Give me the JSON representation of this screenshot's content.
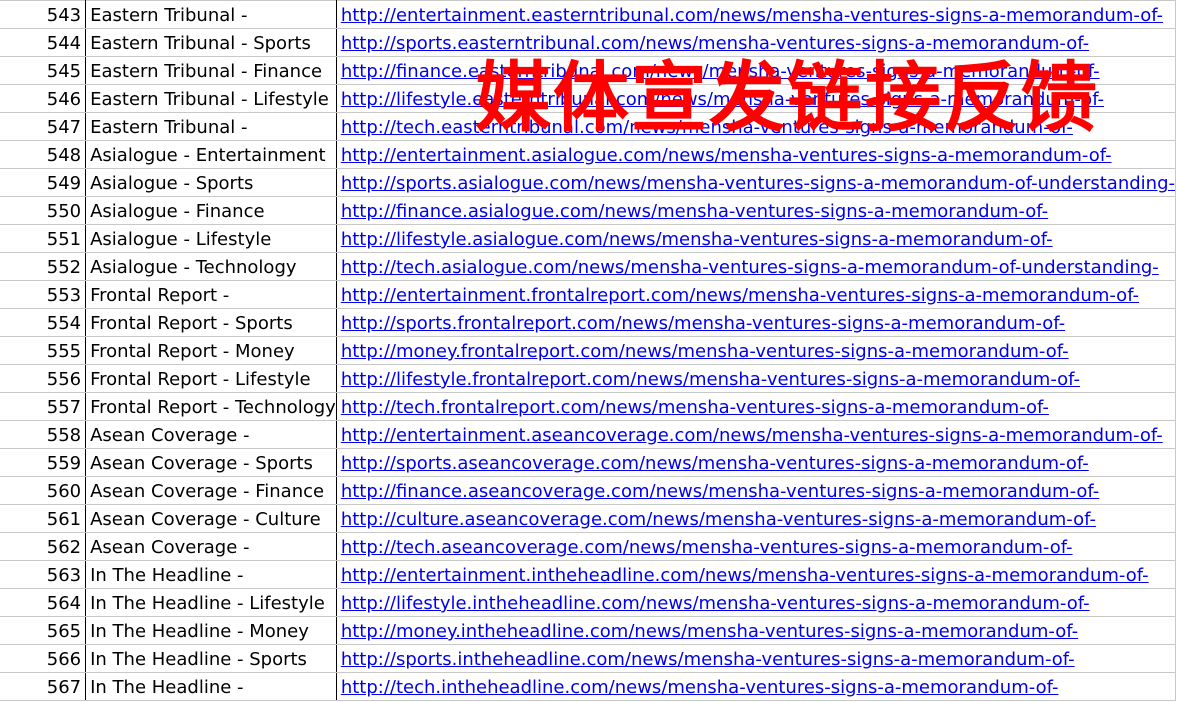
{
  "rows": [
    {
      "num": "543",
      "name": "Eastern Tribunal -",
      "url": "http://entertainment.easterntribunal.com/news/mensha-ventures-signs-a-memorandum-of-"
    },
    {
      "num": "544",
      "name": "Eastern Tribunal - Sports",
      "url": "http://sports.easterntribunal.com/news/mensha-ventures-signs-a-memorandum-of-"
    },
    {
      "num": "545",
      "name": "Eastern Tribunal - Finance",
      "url": "http://finance.easterntribunal.com/news/mensha-ventures-signs-a-memorandum-of-"
    },
    {
      "num": "546",
      "name": "Eastern Tribunal - Lifestyle",
      "url": "http://lifestyle.easterntribunal.com/news/mensha-ventures-signs-a-memorandum-of-"
    },
    {
      "num": "547",
      "name": "Eastern Tribunal -",
      "url": "http://tech.easterntribunal.com/news/mensha-ventures-signs-a-memorandum-of-"
    },
    {
      "num": "548",
      "name": "Asialogue - Entertainment",
      "url": "http://entertainment.asialogue.com/news/mensha-ventures-signs-a-memorandum-of-"
    },
    {
      "num": "549",
      "name": "Asialogue - Sports",
      "url": "http://sports.asialogue.com/news/mensha-ventures-signs-a-memorandum-of-understanding-"
    },
    {
      "num": "550",
      "name": "Asialogue - Finance",
      "url": "http://finance.asialogue.com/news/mensha-ventures-signs-a-memorandum-of-"
    },
    {
      "num": "551",
      "name": "Asialogue - Lifestyle",
      "url": "http://lifestyle.asialogue.com/news/mensha-ventures-signs-a-memorandum-of-"
    },
    {
      "num": "552",
      "name": "Asialogue - Technology",
      "url": "http://tech.asialogue.com/news/mensha-ventures-signs-a-memorandum-of-understanding-"
    },
    {
      "num": "553",
      "name": "Frontal Report -",
      "url": "http://entertainment.frontalreport.com/news/mensha-ventures-signs-a-memorandum-of-"
    },
    {
      "num": "554",
      "name": "Frontal Report - Sports",
      "url": "http://sports.frontalreport.com/news/mensha-ventures-signs-a-memorandum-of-"
    },
    {
      "num": "555",
      "name": "Frontal Report - Money",
      "url": "http://money.frontalreport.com/news/mensha-ventures-signs-a-memorandum-of-"
    },
    {
      "num": "556",
      "name": "Frontal Report - Lifestyle",
      "url": "http://lifestyle.frontalreport.com/news/mensha-ventures-signs-a-memorandum-of-"
    },
    {
      "num": "557",
      "name": "Frontal Report - Technology",
      "url": "http://tech.frontalreport.com/news/mensha-ventures-signs-a-memorandum-of-"
    },
    {
      "num": "558",
      "name": "Asean Coverage -",
      "url": "http://entertainment.aseancoverage.com/news/mensha-ventures-signs-a-memorandum-of-"
    },
    {
      "num": "559",
      "name": "Asean Coverage - Sports",
      "url": "http://sports.aseancoverage.com/news/mensha-ventures-signs-a-memorandum-of-"
    },
    {
      "num": "560",
      "name": "Asean Coverage - Finance",
      "url": "http://finance.aseancoverage.com/news/mensha-ventures-signs-a-memorandum-of-"
    },
    {
      "num": "561",
      "name": "Asean Coverage - Culture",
      "url": "http://culture.aseancoverage.com/news/mensha-ventures-signs-a-memorandum-of-"
    },
    {
      "num": "562",
      "name": "Asean Coverage -",
      "url": "http://tech.aseancoverage.com/news/mensha-ventures-signs-a-memorandum-of-"
    },
    {
      "num": "563",
      "name": "In The Headline -",
      "url": "http://entertainment.intheheadline.com/news/mensha-ventures-signs-a-memorandum-of-"
    },
    {
      "num": "564",
      "name": "In The Headline - Lifestyle",
      "url": "http://lifestyle.intheheadline.com/news/mensha-ventures-signs-a-memorandum-of-"
    },
    {
      "num": "565",
      "name": "In The Headline - Money",
      "url": "http://money.intheheadline.com/news/mensha-ventures-signs-a-memorandum-of-"
    },
    {
      "num": "566",
      "name": "In The Headline - Sports",
      "url": "http://sports.intheheadline.com/news/mensha-ventures-signs-a-memorandum-of-"
    },
    {
      "num": "567",
      "name": "In The Headline -",
      "url": "http://tech.intheheadline.com/news/mensha-ventures-signs-a-memorandum-of-"
    }
  ],
  "watermark": "媒体宣发链接反馈",
  "colors": {
    "link": "#0000ee",
    "watermark": "#ff0000",
    "gridline": "#c8c8c8"
  }
}
